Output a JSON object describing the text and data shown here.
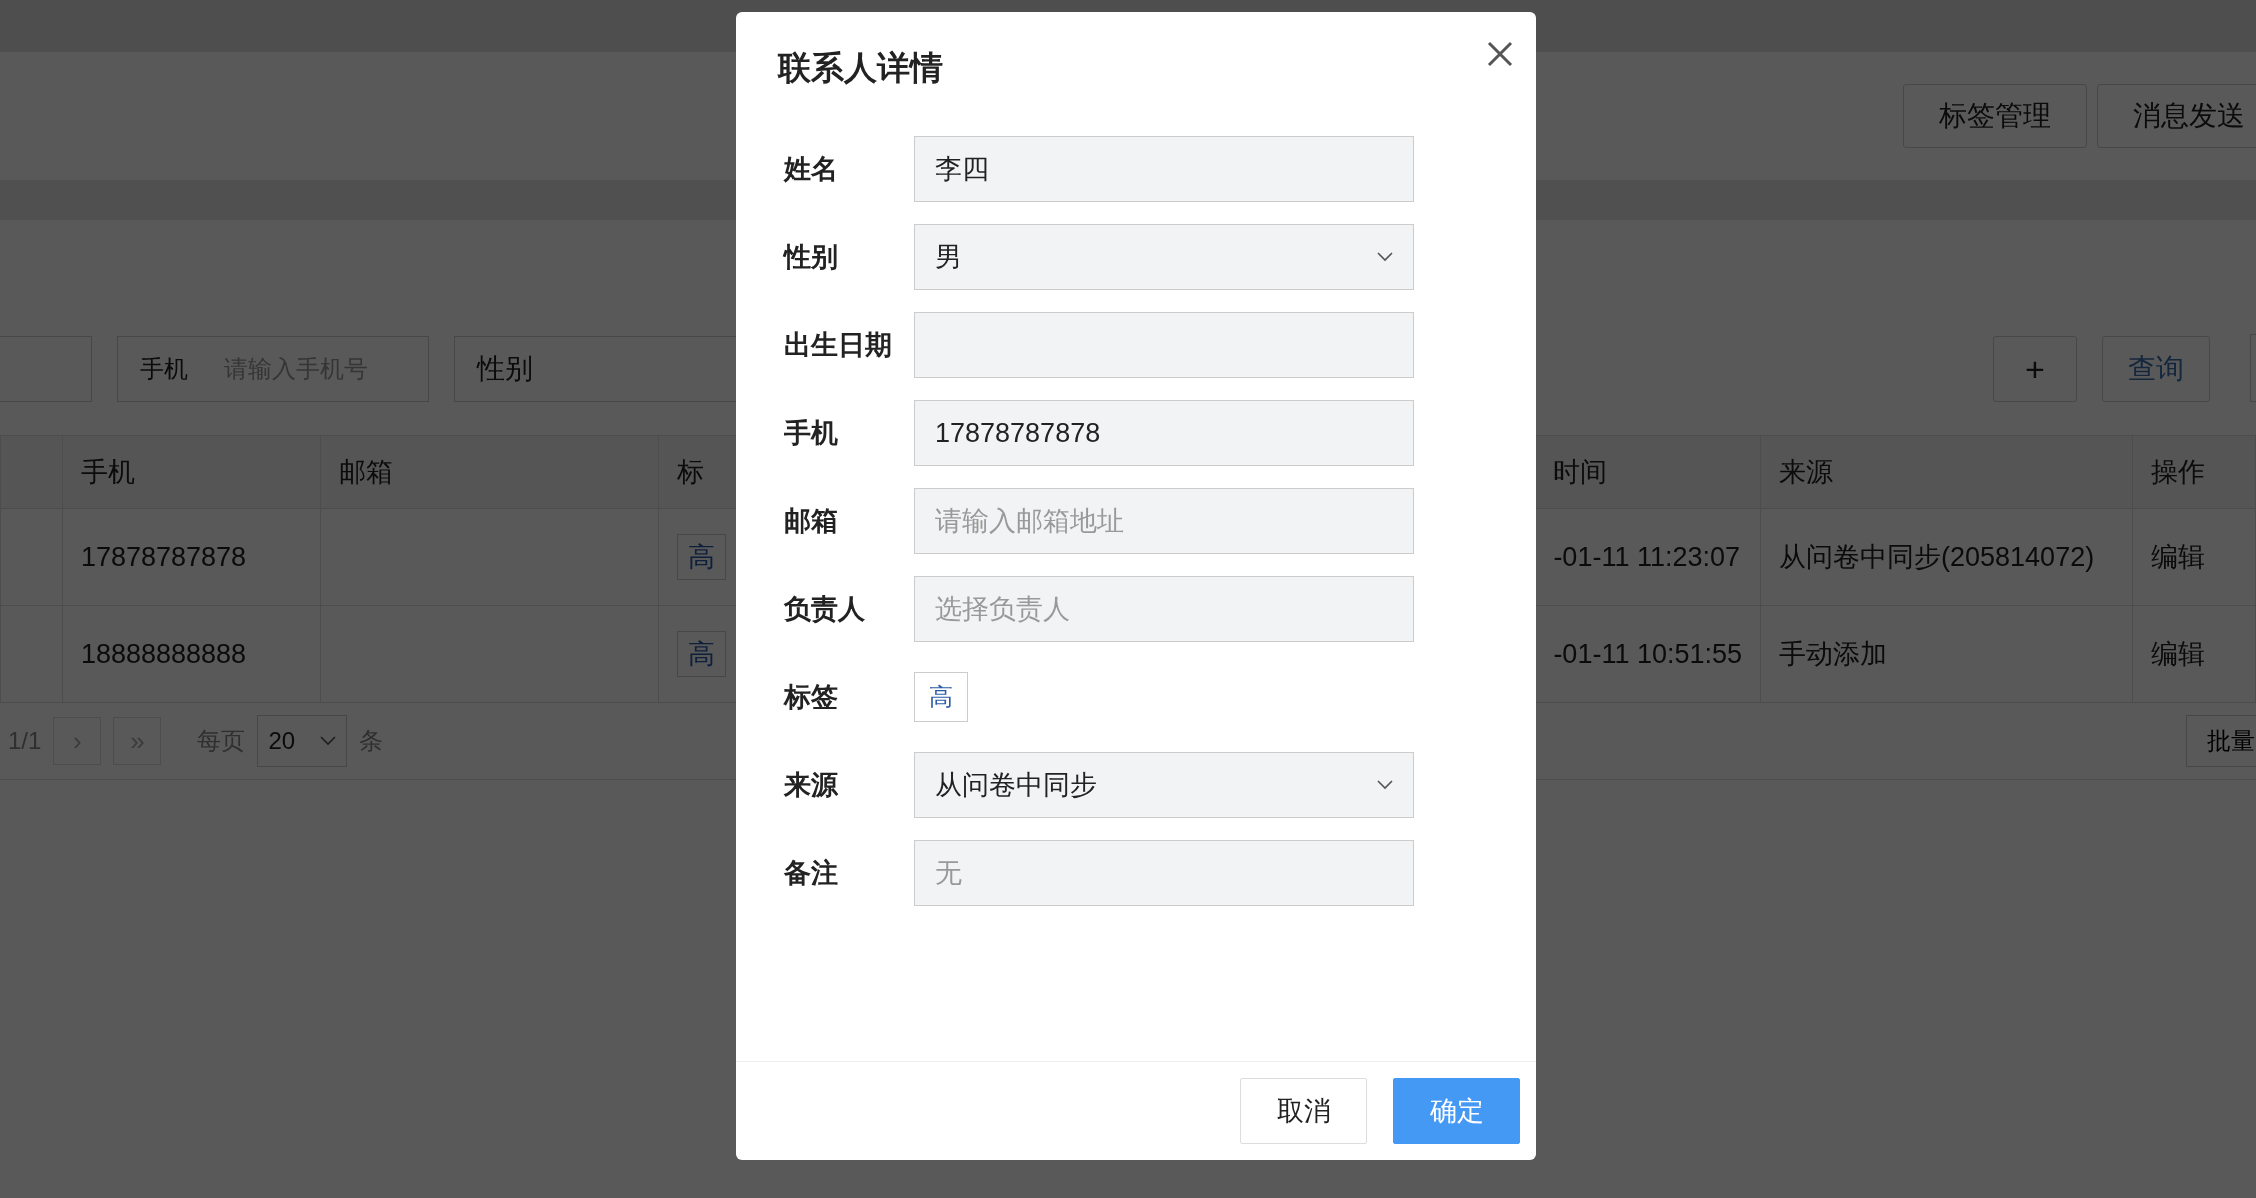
{
  "page": {
    "header_buttons": [
      "标签管理",
      "消息发送"
    ],
    "filters": [
      {
        "kind": "blank"
      },
      {
        "kind": "input",
        "label": "手机",
        "placeholder": "请输入手机号"
      },
      {
        "kind": "select",
        "label": "性别"
      }
    ],
    "add_button": "+",
    "query_button": "查询",
    "table": {
      "columns": [
        "",
        "手机",
        "邮箱",
        "标",
        "时间",
        "来源",
        "操作"
      ],
      "rows": [
        {
          "cells": [
            "",
            "17878787878",
            "",
            "高",
            "-01-11 11:23:07",
            "从问卷中同步(205814072)",
            "编辑"
          ]
        },
        {
          "cells": [
            "",
            "18888888888",
            "",
            "高",
            "-01-11 10:51:55",
            "手动添加",
            "编辑"
          ]
        }
      ]
    },
    "pagination": {
      "page": "1/1",
      "next": "›",
      "last": "»",
      "per_page_label": "每页",
      "per_page": "20",
      "unit": "条"
    },
    "batch_button": "批量"
  },
  "dialog": {
    "title": "联系人详情",
    "fields": [
      {
        "kind": "input",
        "label": "姓名",
        "value": "李四"
      },
      {
        "kind": "select",
        "label": "性别",
        "value": "男"
      },
      {
        "kind": "input",
        "label": "出生日期"
      },
      {
        "kind": "input",
        "label": "手机",
        "value": "17878787878"
      },
      {
        "kind": "input",
        "label": "邮箱",
        "placeholder": "请输入邮箱地址"
      },
      {
        "kind": "input",
        "label": "负责人",
        "placeholder": "选择负责人"
      },
      {
        "kind": "tag",
        "label": "标签",
        "value": "高"
      },
      {
        "kind": "select",
        "label": "来源",
        "value": "从问卷中同步"
      },
      {
        "kind": "input",
        "label": "备注",
        "placeholder": "无"
      }
    ],
    "buttons": [
      {
        "label": "取消",
        "primary": false
      },
      {
        "label": "确定",
        "primary": true
      }
    ]
  }
}
